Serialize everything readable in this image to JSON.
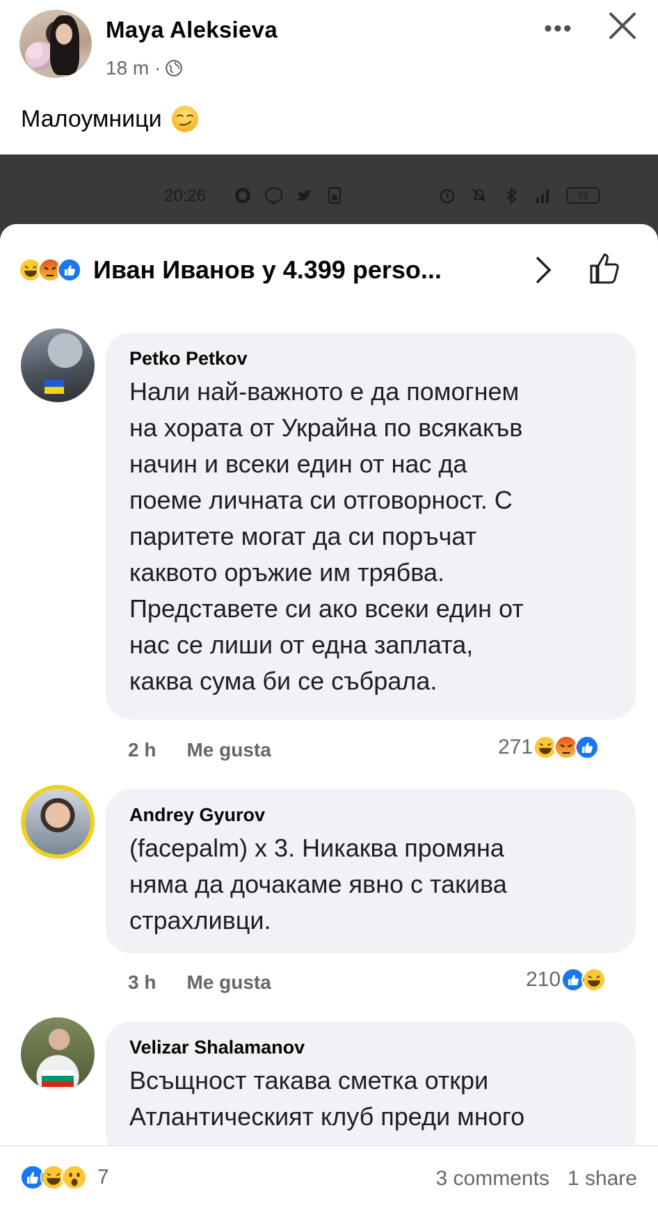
{
  "post": {
    "author": "Maya Aleksieva",
    "time": "18 m ·",
    "text": "Малоумници",
    "icons": {
      "more": "more-dots-icon",
      "close": "close-icon",
      "privacy": "globe-icon",
      "emoji": "smirk-emoji-icon"
    }
  },
  "status_bar": {
    "time": "20:26",
    "battery": "59"
  },
  "reactions_header": {
    "text": "Иван Иванов y 4.399 perso...",
    "icons": [
      "haha-reaction-icon",
      "angry-reaction-icon",
      "like-reaction-icon"
    ]
  },
  "comments": [
    {
      "name": "Petko Petkov",
      "lines": [
        "Нали най-важното е да помогнем",
        "на хората от Украйна по всякакъв",
        "начин и всеки един от нас да",
        "поеме личната си отговорност. С",
        "паритете могат да си поръчат",
        "каквото оръжие им трябва.",
        "Представете си ако всеки един от",
        "нас се лиши от една заплата,",
        "каква сума би се събрала."
      ],
      "time": "2 h",
      "like_label": "Me gusta",
      "reaction_count": "271",
      "reaction_icons": [
        "haha-reaction-icon",
        "angry-reaction-icon",
        "like-reaction-icon"
      ]
    },
    {
      "name": "Andrey Gyurov",
      "lines": [
        "(facepalm) x 3. Никаква промяна",
        "няма да дочакаме явно с такива",
        "страхливци."
      ],
      "time": "3 h",
      "like_label": "Me gusta",
      "reaction_count": "210",
      "reaction_icons": [
        "like-reaction-icon",
        "haha-reaction-icon"
      ]
    },
    {
      "name": "Velizar Shalamanov",
      "lines": [
        "Всъщност такава сметка откри",
        "Атлантическият клуб преди много"
      ]
    }
  ],
  "bottom": {
    "reaction_count": "7",
    "comments": "3 comments",
    "shares": "1 share",
    "reaction_icons": [
      "like-reaction-icon",
      "haha-reaction-icon",
      "wow-reaction-icon"
    ]
  },
  "colors": {
    "facebook_blue": "#1877f2",
    "bubble_gray": "#f0f2f5",
    "meta_gray": "#65676b"
  }
}
